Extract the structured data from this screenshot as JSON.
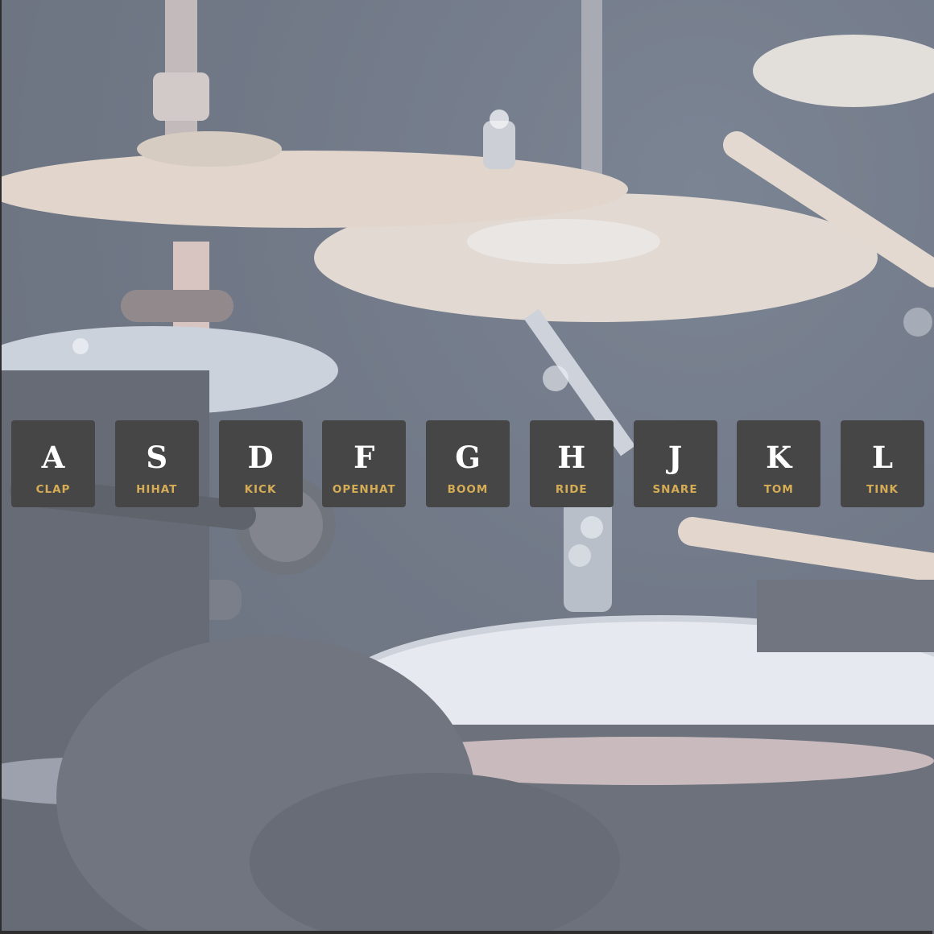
{
  "keys": [
    {
      "key": "A",
      "sound": "CLAP"
    },
    {
      "key": "S",
      "sound": "HIHAT"
    },
    {
      "key": "D",
      "sound": "KICK"
    },
    {
      "key": "F",
      "sound": "OPENHAT"
    },
    {
      "key": "G",
      "sound": "BOOM"
    },
    {
      "key": "H",
      "sound": "RIDE"
    },
    {
      "key": "J",
      "sound": "SNARE"
    },
    {
      "key": "K",
      "sound": "TOM"
    },
    {
      "key": "L",
      "sound": "TINK"
    }
  ],
  "colors": {
    "key_background": "#464646",
    "key_letter": "#ffffff",
    "sound_label": "#d6ad55"
  }
}
